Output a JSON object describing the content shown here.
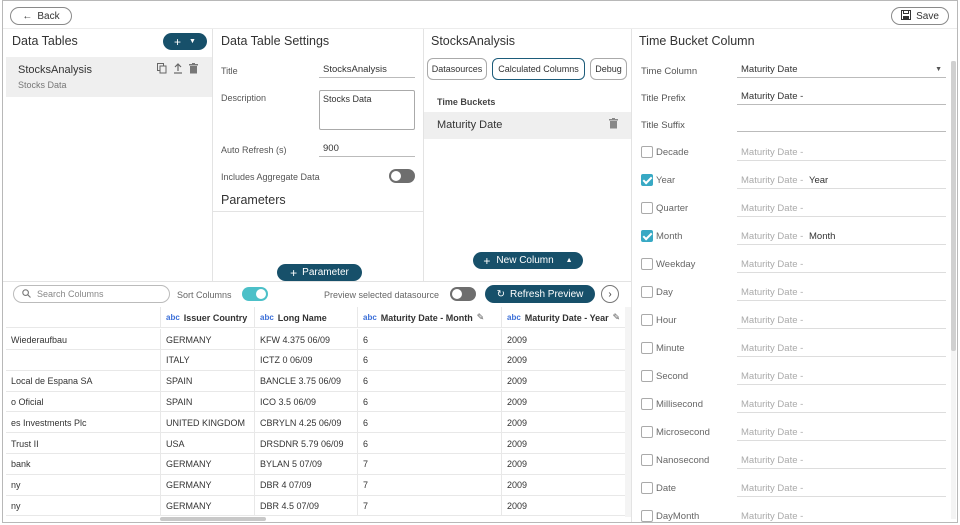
{
  "header": {
    "back_label": "Back",
    "save_label": "Save"
  },
  "data_tables": {
    "title": "Data Tables",
    "items": [
      {
        "name": "StocksAnalysis",
        "description": "Stocks Data"
      }
    ]
  },
  "settings": {
    "title": "Data Table Settings",
    "title_label": "Title",
    "title_value": "StocksAnalysis",
    "description_label": "Description",
    "description_value": "Stocks Data",
    "auto_refresh_label": "Auto Refresh (s)",
    "auto_refresh_value": "900",
    "aggregate_label": "Includes Aggregate Data",
    "aggregate_on": false,
    "parameters_title": "Parameters",
    "parameter_button": "Parameter"
  },
  "stocks": {
    "title": "StocksAnalysis",
    "tabs": [
      "Datasources",
      "Calculated Columns",
      "Debug"
    ],
    "active_tab": "Calculated Columns",
    "section_label": "Time Buckets",
    "buckets": [
      "Maturity Date"
    ],
    "new_column_button": "New Column"
  },
  "time_bucket": {
    "title": "Time Bucket Column",
    "time_column_label": "Time Column",
    "time_column_value": "Maturity Date",
    "prefix_label": "Title Prefix",
    "prefix_value": "Maturity Date -",
    "suffix_label": "Title Suffix",
    "suffix_value": "",
    "field_prefix": "Maturity Date -",
    "options": [
      {
        "label": "Decade",
        "checked": false,
        "suffix": ""
      },
      {
        "label": "Year",
        "checked": true,
        "suffix": "Year"
      },
      {
        "label": "Quarter",
        "checked": false,
        "suffix": ""
      },
      {
        "label": "Month",
        "checked": true,
        "suffix": "Month"
      },
      {
        "label": "Weekday",
        "checked": false,
        "suffix": ""
      },
      {
        "label": "Day",
        "checked": false,
        "suffix": ""
      },
      {
        "label": "Hour",
        "checked": false,
        "suffix": ""
      },
      {
        "label": "Minute",
        "checked": false,
        "suffix": ""
      },
      {
        "label": "Second",
        "checked": false,
        "suffix": ""
      },
      {
        "label": "Millisecond",
        "checked": false,
        "suffix": ""
      },
      {
        "label": "Microsecond",
        "checked": false,
        "suffix": ""
      },
      {
        "label": "Nanosecond",
        "checked": false,
        "suffix": ""
      },
      {
        "label": "Date",
        "checked": false,
        "suffix": ""
      },
      {
        "label": "DayMonth",
        "checked": false,
        "suffix": ""
      }
    ]
  },
  "toolbar": {
    "search_placeholder": "Search Columns",
    "sort_label": "Sort Columns",
    "sort_on": true,
    "preview_label": "Preview selected datasource",
    "preview_on": false,
    "refresh_button": "Refresh Preview"
  },
  "grid": {
    "type_badge": "abc",
    "headers": [
      "",
      "Issuer Country",
      "Long Name",
      "Maturity Date - Month",
      "Maturity Date - Year"
    ],
    "rows": [
      [
        "Wiederaufbau",
        "GERMANY",
        "KFW 4.375 06/09",
        "6",
        "2009"
      ],
      [
        "",
        "ITALY",
        "ICTZ 0 06/09",
        "6",
        "2009"
      ],
      [
        "Local de Espana SA",
        "SPAIN",
        "BANCLE 3.75 06/09",
        "6",
        "2009"
      ],
      [
        "o Oficial",
        "SPAIN",
        "ICO 3.5 06/09",
        "6",
        "2009"
      ],
      [
        "es Investments Plc",
        "UNITED KINGDOM",
        "CBRYLN 4.25 06/09",
        "6",
        "2009"
      ],
      [
        "Trust II",
        "USA",
        "DRSDNR 5.79 06/09",
        "6",
        "2009"
      ],
      [
        "bank",
        "GERMANY",
        "BYLAN 5 07/09",
        "7",
        "2009"
      ],
      [
        "ny",
        "GERMANY",
        "DBR 4 07/09",
        "7",
        "2009"
      ],
      [
        "ny",
        "GERMANY",
        "DBR 4.5 07/09",
        "7",
        "2009"
      ]
    ]
  }
}
